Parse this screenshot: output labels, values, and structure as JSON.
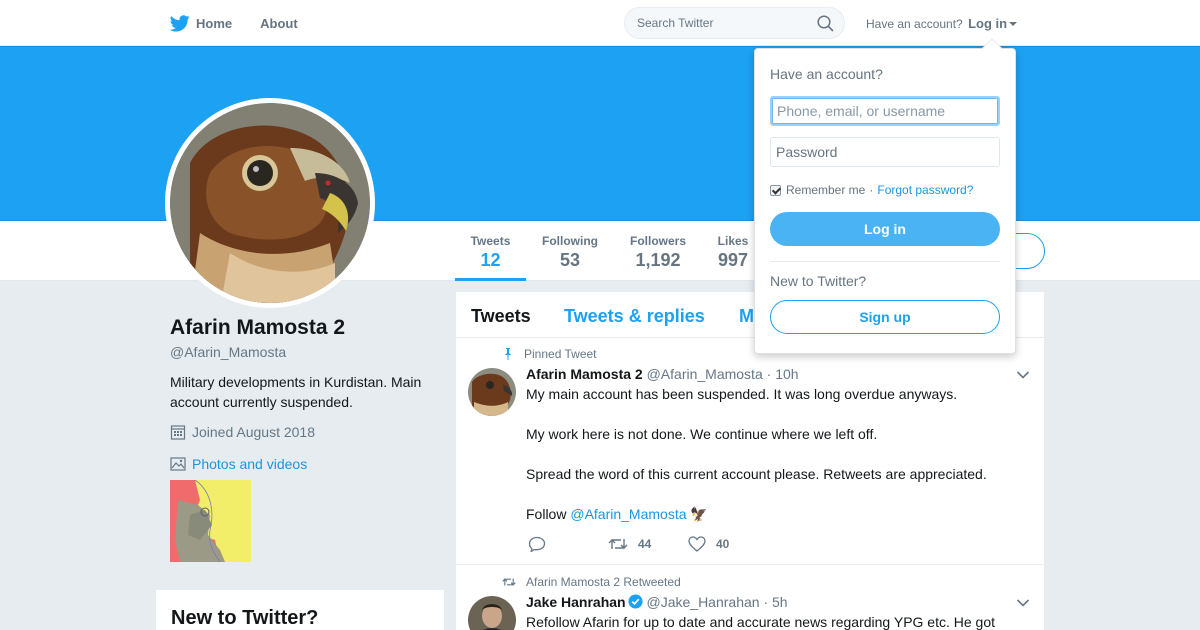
{
  "nav": {
    "home": "Home",
    "about": "About",
    "search_placeholder": "Search Twitter",
    "account_prompt": "Have an account?",
    "login": "Log in"
  },
  "profile": {
    "name": "Afarin Mamosta 2",
    "handle": "@Afarin_Mamosta",
    "bio": "Military developments in Kurdistan. Main account currently suspended.",
    "joined": "Joined August 2018",
    "photos_label": "Photos and videos"
  },
  "stats": [
    {
      "label": "Tweets",
      "value": "12"
    },
    {
      "label": "Following",
      "value": "53"
    },
    {
      "label": "Followers",
      "value": "1,192"
    },
    {
      "label": "Likes",
      "value": "997"
    }
  ],
  "timeline": {
    "tabs": [
      "Tweets",
      "Tweets & replies",
      "M"
    ]
  },
  "tweets": [
    {
      "context": "Pinned Tweet",
      "fullname": "Afarin Mamosta 2",
      "username": "@Afarin_Mamosta",
      "time": "· 10h",
      "paragraphs": [
        "My main account has been suspended. It was long overdue anyways.",
        "My work here is not done. We continue where we left off.",
        "Spread the word of this current account please. Retweets are appreciated."
      ],
      "follow_prefix": "Follow",
      "follow_mention": "@Afarin_Mamosta",
      "follow_emoji": "🦅",
      "retweets": "44",
      "likes": "40"
    },
    {
      "context": "Afarin Mamosta 2 Retweeted",
      "fullname": "Jake Hanrahan",
      "username": "@Jake_Hanrahan",
      "time": "· 5h",
      "text": "Refollow Afarin for up to date and accurate news regarding YPG etc. He got"
    }
  ],
  "sidebar": {
    "new_to_twitter": "New to Twitter?"
  },
  "login_dropdown": {
    "heading": "Have an account?",
    "username_placeholder": "Phone, email, or username",
    "password_placeholder": "Password",
    "remember_me": "Remember me",
    "separator": "·",
    "forgot_password": "Forgot password?",
    "login_button": "Log in",
    "new_heading": "New to Twitter?",
    "signup_button": "Sign up"
  },
  "colors": {
    "brand": "#1da1f2",
    "banner": "#1da1f2",
    "link": "#1b95e0"
  }
}
